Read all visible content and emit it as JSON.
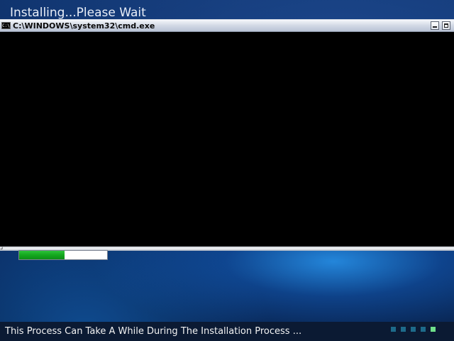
{
  "installer": {
    "heading": "Installing...Please Wait"
  },
  "cmd_window": {
    "title": "C:\\WINDOWS\\system32\\cmd.exe",
    "icon_text": "C:\\"
  },
  "progress": {
    "fraction": 0.52,
    "color": "#14a81e"
  },
  "status": {
    "message": "This Process Can Take A While During The Installation Process ..."
  },
  "step_indicator": {
    "total": 5,
    "active_index": 4,
    "color_inactive": "#1d6a8a",
    "color_active": "#6fe08a"
  }
}
